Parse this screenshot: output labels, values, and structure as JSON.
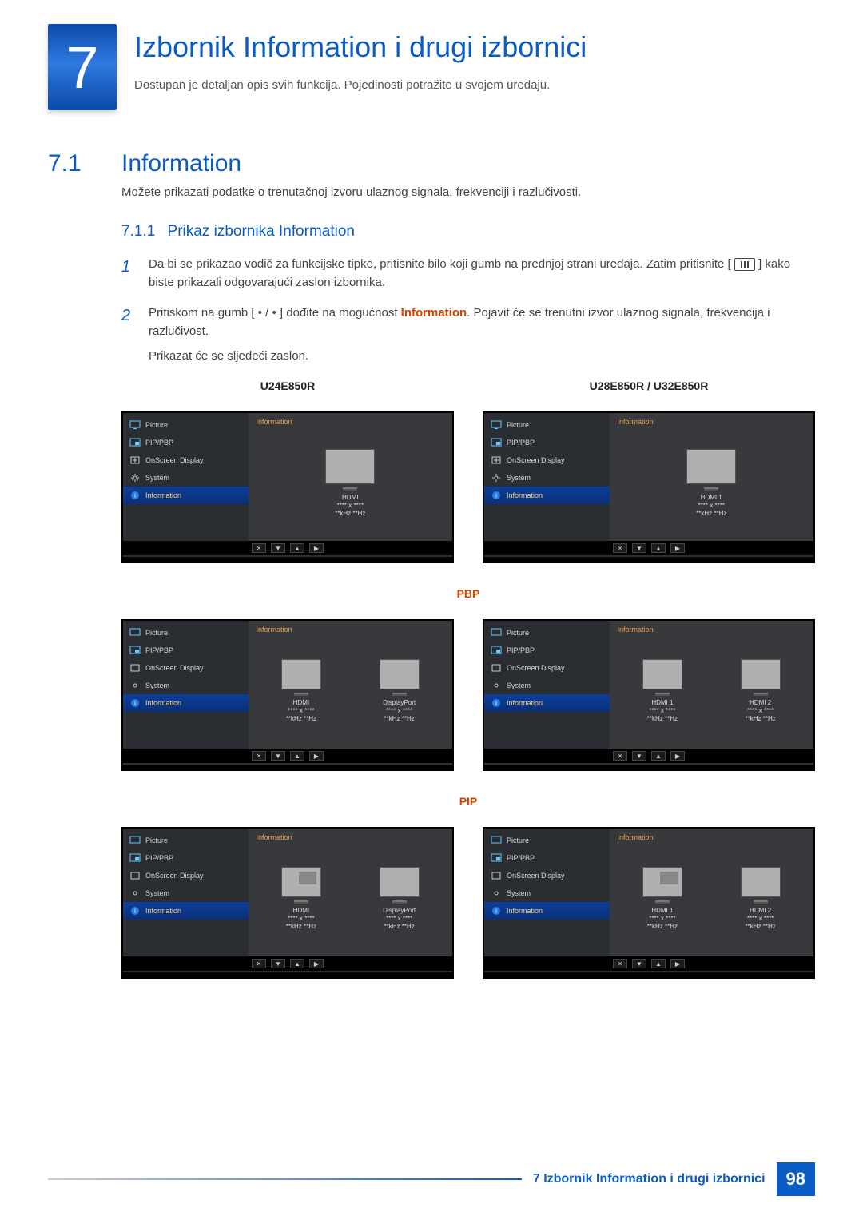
{
  "chapter": {
    "num": "7",
    "title": "Izbornik Information i drugi izbornici",
    "sub": "Dostupan je detaljan opis svih funkcija. Pojedinosti potražite u svojem uređaju."
  },
  "section": {
    "num": "7.1",
    "title": "Information",
    "body": "Možete prikazati podatke o trenutačnoj izvoru ulaznog signala, frekvenciji i razlučivosti."
  },
  "subsection": {
    "num": "7.1.1",
    "title": "Prikaz izbornika Information"
  },
  "steps": {
    "s1_num": "1",
    "s1_a": "Da bi se prikazao vodič za funkcijske tipke, pritisnite bilo koji gumb na prednjoj strani uređaja. Zatim pritisnite [ ",
    "s1_b": " ] kako biste prikazali odgovarajući zaslon izbornika.",
    "s2_num": "2",
    "s2_a": "Pritiskom na gumb [ • / • ] dođite na mogućnost ",
    "s2_hl": "Information",
    "s2_b": ". Pojavit će se trenutni izvor ulaznog signala, frekvencija i razlučivost.",
    "s2_c": "Prikazat će se sljedeći zaslon."
  },
  "models": {
    "left": "U24E850R",
    "right": "U28E850R / U32E850R"
  },
  "modes": {
    "pbp": "PBP",
    "pip": "PIP"
  },
  "osd": {
    "content_title": "Information",
    "menu": {
      "picture": "Picture",
      "pipp": "PIP/PBP",
      "osd": "OnScreen Display",
      "system": "System",
      "info": "Information"
    },
    "nav": {
      "close": "✕",
      "down": "▼",
      "up": "▲",
      "right": "▶"
    },
    "sig": {
      "hdmi": "HDMI\n**** x ****\n**kHz **Hz",
      "hdmi1": "HDMI 1\n**** x ****\n**kHz **Hz",
      "hdmi2": "HDMI 2\n**** x ****\n**kHz **Hz",
      "dp": "DisplayPort\n**** x ****\n**kHz **Hz"
    }
  },
  "footer": {
    "text": "7 Izbornik Information i drugi izbornici",
    "page": "98"
  }
}
